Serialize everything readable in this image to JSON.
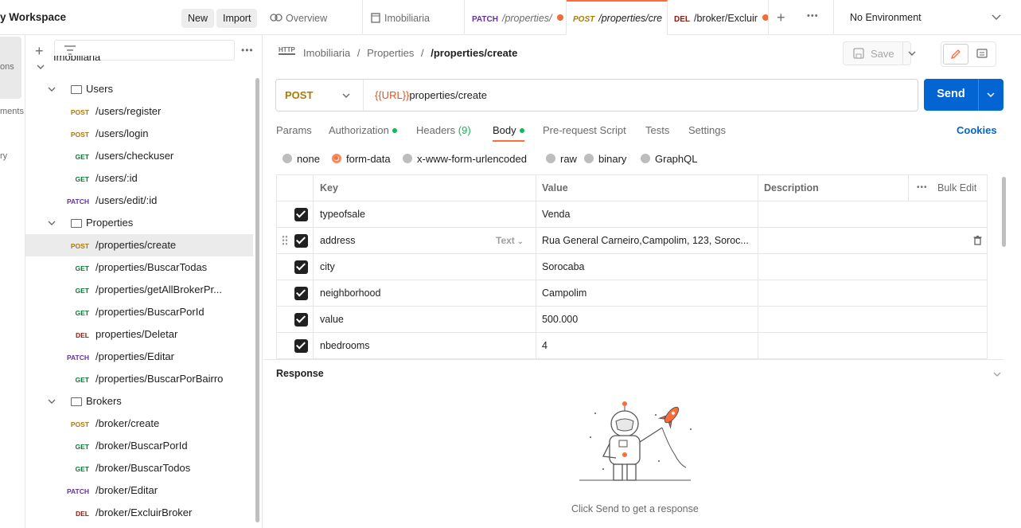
{
  "workspace": {
    "title": "y Workspace",
    "new_label": "New",
    "import_label": "Import"
  },
  "tabs": [
    {
      "method": "",
      "label": "Overview"
    },
    {
      "method": "",
      "label": "Imobiliaria"
    },
    {
      "method": "PATCH",
      "label": "/properties/"
    },
    {
      "method": "POST",
      "label": "/properties/cre"
    },
    {
      "method": "DEL",
      "label": "/broker/Excluir"
    }
  ],
  "environment": "No Environment",
  "rail": {
    "item1": "ons",
    "item2": "ments",
    "item3": "ry"
  },
  "sidebar": {
    "collection": "Imobiliaria",
    "items": [
      {
        "type": "folder",
        "label": "Users"
      },
      {
        "type": "req",
        "method": "POST",
        "label": "/users/register"
      },
      {
        "type": "req",
        "method": "POST",
        "label": "/users/login"
      },
      {
        "type": "req",
        "method": "GET",
        "label": "/users/checkuser"
      },
      {
        "type": "req",
        "method": "GET",
        "label": "/users/:id"
      },
      {
        "type": "req",
        "method": "PATCH",
        "label": "/users/edit/:id"
      },
      {
        "type": "folder",
        "label": "Properties"
      },
      {
        "type": "req",
        "method": "POST",
        "label": "/properties/create"
      },
      {
        "type": "req",
        "method": "GET",
        "label": "/properties/BuscarTodas"
      },
      {
        "type": "req",
        "method": "GET",
        "label": "/properties/getAllBrokerPr..."
      },
      {
        "type": "req",
        "method": "GET",
        "label": "/properties/BuscarPorId"
      },
      {
        "type": "req",
        "method": "DEL",
        "label": "properties/Deletar"
      },
      {
        "type": "req",
        "method": "PATCH",
        "label": "/properties/Editar"
      },
      {
        "type": "req",
        "method": "GET",
        "label": "/properties/BuscarPorBairro"
      },
      {
        "type": "folder",
        "label": "Brokers"
      },
      {
        "type": "req",
        "method": "POST",
        "label": "/broker/create"
      },
      {
        "type": "req",
        "method": "GET",
        "label": "/broker/BuscarPorId"
      },
      {
        "type": "req",
        "method": "GET",
        "label": "/broker/BuscarTodos"
      },
      {
        "type": "req",
        "method": "PATCH",
        "label": "/broker/Editar"
      },
      {
        "type": "req",
        "method": "DEL",
        "label": "/broker/ExcluirBroker"
      }
    ]
  },
  "breadcrumb": {
    "icon": "HTTP",
    "p1": "Imobiliaria",
    "sep": "/",
    "p2": "Properties",
    "current": "/properties/create"
  },
  "save_label": "Save",
  "request": {
    "method": "POST",
    "url_var": "{{URL}}",
    "url_path": "properties/create",
    "send_label": "Send"
  },
  "req_tabs": {
    "params": "Params",
    "authorization": "Authorization",
    "headers": "Headers",
    "headers_count": "(9)",
    "body": "Body",
    "prerequest": "Pre-request Script",
    "tests": "Tests",
    "settings": "Settings",
    "cookies": "Cookies"
  },
  "body_types": [
    "none",
    "form-data",
    "x-www-form-urlencoded",
    "raw",
    "binary",
    "GraphQL"
  ],
  "form_table": {
    "headers": {
      "key": "Key",
      "value": "Value",
      "description": "Description",
      "bulk_edit": "Bulk Edit"
    },
    "type_label": "Text",
    "rows": [
      {
        "key": "typeofsale",
        "value": "Venda"
      },
      {
        "key": "address",
        "value": "Rua General Carneiro,Campolim,  123, Soroc..."
      },
      {
        "key": "city",
        "value": "Sorocaba"
      },
      {
        "key": "neighborhood",
        "value": "Campolim"
      },
      {
        "key": "value",
        "value": "500.000"
      },
      {
        "key": "nbedrooms",
        "value": "4"
      }
    ]
  },
  "response": {
    "title": "Response",
    "empty_msg": "Click Send to get a response"
  },
  "colors": {
    "accent": "#ff6c37",
    "send": "#0265d2",
    "post": "#ad7a03",
    "get": "#007f31",
    "patch": "#623497",
    "del": "#8e1a10"
  }
}
